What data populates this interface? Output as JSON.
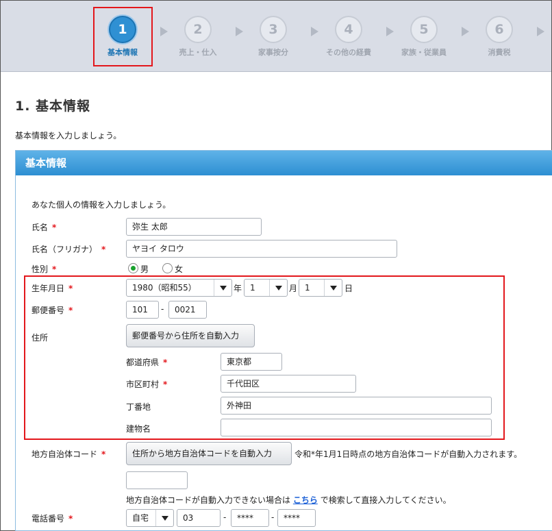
{
  "stepper": {
    "steps": [
      {
        "num": "1",
        "label": "基本情報"
      },
      {
        "num": "2",
        "label": "売上・仕入"
      },
      {
        "num": "3",
        "label": "家事按分"
      },
      {
        "num": "4",
        "label": "その他の経費"
      },
      {
        "num": "5",
        "label": "家族・従業員"
      },
      {
        "num": "6",
        "label": "消費税"
      }
    ]
  },
  "page": {
    "title": "1.  基本情報",
    "intro": "基本情報を入力しましょう。"
  },
  "panel": {
    "title": "基本情報",
    "description": "あなた個人の情報を入力しましょう。",
    "required_mark": "*",
    "name": {
      "label": "氏名",
      "value": "弥生 太郎"
    },
    "name_kana": {
      "label": "氏名（フリガナ）",
      "value": "ヤヨイ タロウ"
    },
    "gender": {
      "label": "性別",
      "male": "男",
      "female": "女"
    },
    "birth": {
      "label": "生年月日",
      "year": "1980（昭和55）",
      "year_suffix": "年",
      "month": "1",
      "month_suffix": "月",
      "day": "1",
      "day_suffix": "日"
    },
    "postal": {
      "label": "郵便番号",
      "part1": "101",
      "dash": "-",
      "part2": "0021"
    },
    "address": {
      "label": "住所",
      "auto_button": "郵便番号から住所を自動入力",
      "prefecture": {
        "label": "都道府県",
        "value": "東京都"
      },
      "city": {
        "label": "市区町村",
        "value": "千代田区"
      },
      "block": {
        "label": "丁番地",
        "value": "外神田"
      },
      "building": {
        "label": "建物名",
        "value": ""
      }
    },
    "municipality": {
      "label": "地方自治体コード",
      "auto_button": "住所から地方自治体コードを自動入力",
      "note": "令和*年1月1日時点の地方自治体コードが自動入力されます。",
      "value": "",
      "help_before": "地方自治体コードが自動入力できない場合は",
      "help_link": "こちら",
      "help_after": "で検索して直接入力してください。"
    },
    "phone": {
      "label": "電話番号",
      "type": "自宅",
      "part1": "03",
      "dash1": "-",
      "part2": "****",
      "dash2": "-",
      "part3": "****"
    }
  }
}
